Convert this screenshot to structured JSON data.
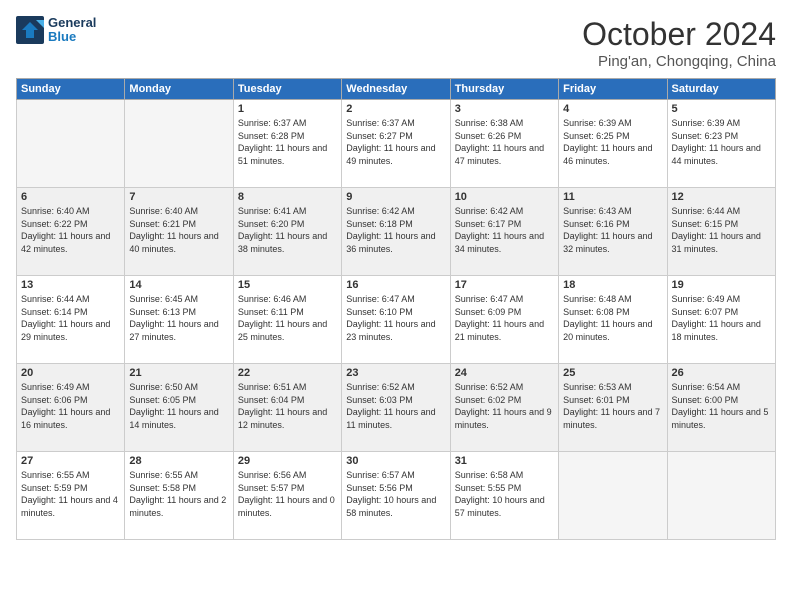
{
  "header": {
    "logo_line1": "General",
    "logo_line2": "Blue",
    "month": "October 2024",
    "location": "Ping'an, Chongqing, China"
  },
  "weekdays": [
    "Sunday",
    "Monday",
    "Tuesday",
    "Wednesday",
    "Thursday",
    "Friday",
    "Saturday"
  ],
  "weeks": [
    [
      {
        "day": "",
        "empty": true
      },
      {
        "day": "",
        "empty": true
      },
      {
        "day": "1",
        "sunrise": "6:37 AM",
        "sunset": "6:28 PM",
        "daylight": "11 hours and 51 minutes."
      },
      {
        "day": "2",
        "sunrise": "6:37 AM",
        "sunset": "6:27 PM",
        "daylight": "11 hours and 49 minutes."
      },
      {
        "day": "3",
        "sunrise": "6:38 AM",
        "sunset": "6:26 PM",
        "daylight": "11 hours and 47 minutes."
      },
      {
        "day": "4",
        "sunrise": "6:39 AM",
        "sunset": "6:25 PM",
        "daylight": "11 hours and 46 minutes."
      },
      {
        "day": "5",
        "sunrise": "6:39 AM",
        "sunset": "6:23 PM",
        "daylight": "11 hours and 44 minutes."
      }
    ],
    [
      {
        "day": "6",
        "sunrise": "6:40 AM",
        "sunset": "6:22 PM",
        "daylight": "11 hours and 42 minutes."
      },
      {
        "day": "7",
        "sunrise": "6:40 AM",
        "sunset": "6:21 PM",
        "daylight": "11 hours and 40 minutes."
      },
      {
        "day": "8",
        "sunrise": "6:41 AM",
        "sunset": "6:20 PM",
        "daylight": "11 hours and 38 minutes."
      },
      {
        "day": "9",
        "sunrise": "6:42 AM",
        "sunset": "6:18 PM",
        "daylight": "11 hours and 36 minutes."
      },
      {
        "day": "10",
        "sunrise": "6:42 AM",
        "sunset": "6:17 PM",
        "daylight": "11 hours and 34 minutes."
      },
      {
        "day": "11",
        "sunrise": "6:43 AM",
        "sunset": "6:16 PM",
        "daylight": "11 hours and 32 minutes."
      },
      {
        "day": "12",
        "sunrise": "6:44 AM",
        "sunset": "6:15 PM",
        "daylight": "11 hours and 31 minutes."
      }
    ],
    [
      {
        "day": "13",
        "sunrise": "6:44 AM",
        "sunset": "6:14 PM",
        "daylight": "11 hours and 29 minutes."
      },
      {
        "day": "14",
        "sunrise": "6:45 AM",
        "sunset": "6:13 PM",
        "daylight": "11 hours and 27 minutes."
      },
      {
        "day": "15",
        "sunrise": "6:46 AM",
        "sunset": "6:11 PM",
        "daylight": "11 hours and 25 minutes."
      },
      {
        "day": "16",
        "sunrise": "6:47 AM",
        "sunset": "6:10 PM",
        "daylight": "11 hours and 23 minutes."
      },
      {
        "day": "17",
        "sunrise": "6:47 AM",
        "sunset": "6:09 PM",
        "daylight": "11 hours and 21 minutes."
      },
      {
        "day": "18",
        "sunrise": "6:48 AM",
        "sunset": "6:08 PM",
        "daylight": "11 hours and 20 minutes."
      },
      {
        "day": "19",
        "sunrise": "6:49 AM",
        "sunset": "6:07 PM",
        "daylight": "11 hours and 18 minutes."
      }
    ],
    [
      {
        "day": "20",
        "sunrise": "6:49 AM",
        "sunset": "6:06 PM",
        "daylight": "11 hours and 16 minutes."
      },
      {
        "day": "21",
        "sunrise": "6:50 AM",
        "sunset": "6:05 PM",
        "daylight": "11 hours and 14 minutes."
      },
      {
        "day": "22",
        "sunrise": "6:51 AM",
        "sunset": "6:04 PM",
        "daylight": "11 hours and 12 minutes."
      },
      {
        "day": "23",
        "sunrise": "6:52 AM",
        "sunset": "6:03 PM",
        "daylight": "11 hours and 11 minutes."
      },
      {
        "day": "24",
        "sunrise": "6:52 AM",
        "sunset": "6:02 PM",
        "daylight": "11 hours and 9 minutes."
      },
      {
        "day": "25",
        "sunrise": "6:53 AM",
        "sunset": "6:01 PM",
        "daylight": "11 hours and 7 minutes."
      },
      {
        "day": "26",
        "sunrise": "6:54 AM",
        "sunset": "6:00 PM",
        "daylight": "11 hours and 5 minutes."
      }
    ],
    [
      {
        "day": "27",
        "sunrise": "6:55 AM",
        "sunset": "5:59 PM",
        "daylight": "11 hours and 4 minutes."
      },
      {
        "day": "28",
        "sunrise": "6:55 AM",
        "sunset": "5:58 PM",
        "daylight": "11 hours and 2 minutes."
      },
      {
        "day": "29",
        "sunrise": "6:56 AM",
        "sunset": "5:57 PM",
        "daylight": "11 hours and 0 minutes."
      },
      {
        "day": "30",
        "sunrise": "6:57 AM",
        "sunset": "5:56 PM",
        "daylight": "10 hours and 58 minutes."
      },
      {
        "day": "31",
        "sunrise": "6:58 AM",
        "sunset": "5:55 PM",
        "daylight": "10 hours and 57 minutes."
      },
      {
        "day": "",
        "empty": true
      },
      {
        "day": "",
        "empty": true
      }
    ]
  ]
}
